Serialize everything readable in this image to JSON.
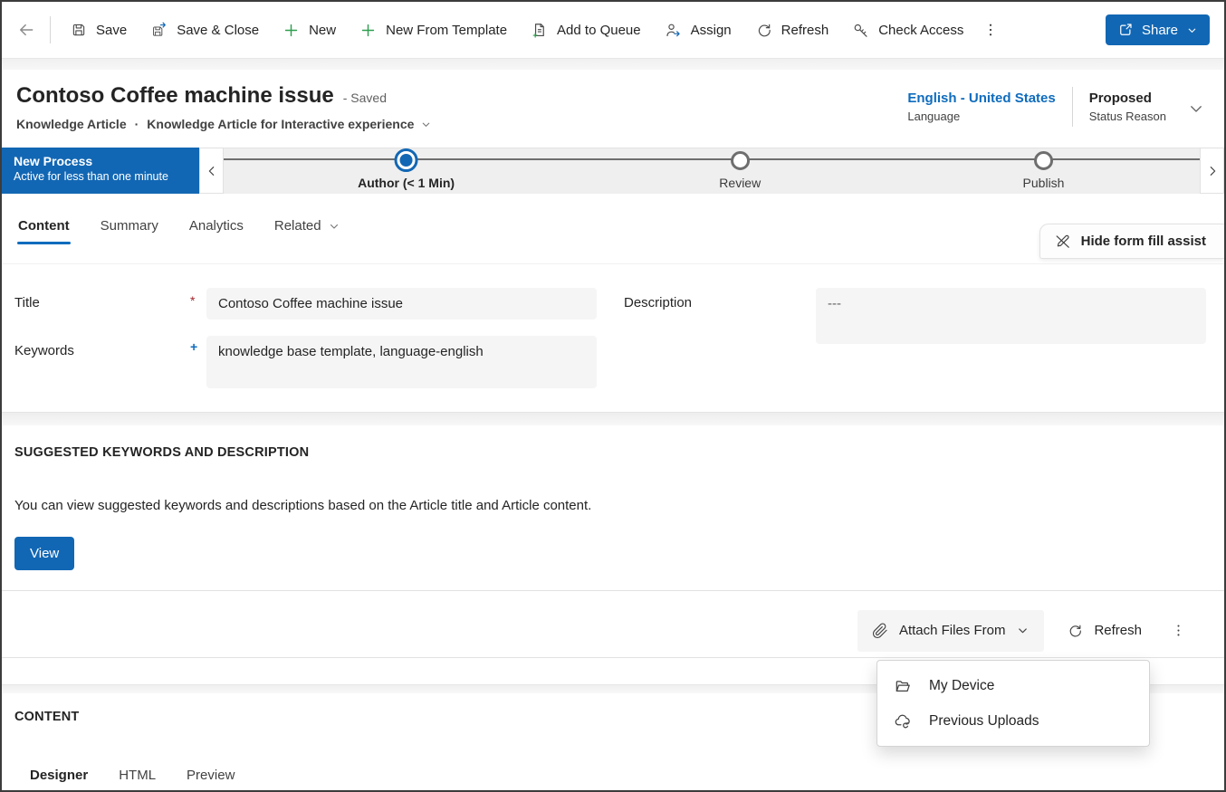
{
  "colors": {
    "accent": "#1267b4",
    "link_blue": "#0f6cbd",
    "green": "#2e9e4f",
    "required_red": "#a4262c",
    "input_bg": "#f5f5f5"
  },
  "icons": {
    "back": "arrow-left",
    "save": "floppy-disk",
    "save_close": "floppy-disk-arrow",
    "new": "plus",
    "new_from_template": "plus",
    "add_to_queue": "document-plus",
    "assign": "person-arrow",
    "refresh": "circular-arrow",
    "check_access": "key",
    "more": "vertical-dots",
    "share": "share-box-arrow",
    "form_fill_assist": "pen-slash",
    "attach": "paperclip",
    "my_device": "open-folder",
    "previous_uploads": "cloud-sync"
  },
  "command_bar": {
    "items": [
      {
        "label": "Save"
      },
      {
        "label": "Save & Close"
      },
      {
        "label": "New"
      },
      {
        "label": "New From Template"
      },
      {
        "label": "Add to Queue"
      },
      {
        "label": "Assign"
      },
      {
        "label": "Refresh"
      },
      {
        "label": "Check Access"
      }
    ],
    "share_label": "Share"
  },
  "header": {
    "title": "Contoso Coffee machine issue",
    "save_status": "- Saved",
    "entity": "Knowledge Article",
    "separator": "·",
    "form_name": "Knowledge Article for Interactive experience",
    "language_value": "English - United States",
    "language_label": "Language",
    "status_value": "Proposed",
    "status_label": "Status Reason"
  },
  "process": {
    "name": "New Process",
    "active_for": "Active for less than one minute",
    "stages": [
      {
        "label": "Author  (< 1 Min)",
        "state": "active"
      },
      {
        "label": "Review",
        "state": "inactive"
      },
      {
        "label": "Publish",
        "state": "inactive"
      }
    ]
  },
  "tabs": [
    {
      "label": "Content",
      "active": true
    },
    {
      "label": "Summary",
      "active": false
    },
    {
      "label": "Analytics",
      "active": false
    },
    {
      "label": "Related",
      "active": false,
      "has_dropdown": true
    }
  ],
  "form_fill_assist_label": "Hide form fill assist",
  "form": {
    "required_marker": "*",
    "recommended_marker": "+",
    "title_label": "Title",
    "title_value": "Contoso Coffee machine issue",
    "keywords_label": "Keywords",
    "keywords_value": "knowledge base template, language-english",
    "description_label": "Description",
    "description_value": "---"
  },
  "suggested": {
    "heading": "SUGGESTED KEYWORDS AND DESCRIPTION",
    "body": "You can view suggested keywords and descriptions based on the Article title and Article content.",
    "view_label": "View"
  },
  "attachments": {
    "attach_label": "Attach Files From",
    "refresh_label": "Refresh",
    "menu": [
      {
        "label": "My Device"
      },
      {
        "label": "Previous Uploads"
      }
    ]
  },
  "content_section": {
    "heading": "CONTENT",
    "tabs": [
      {
        "label": "Designer",
        "active": true
      },
      {
        "label": "HTML",
        "active": false
      },
      {
        "label": "Preview",
        "active": false
      }
    ]
  }
}
